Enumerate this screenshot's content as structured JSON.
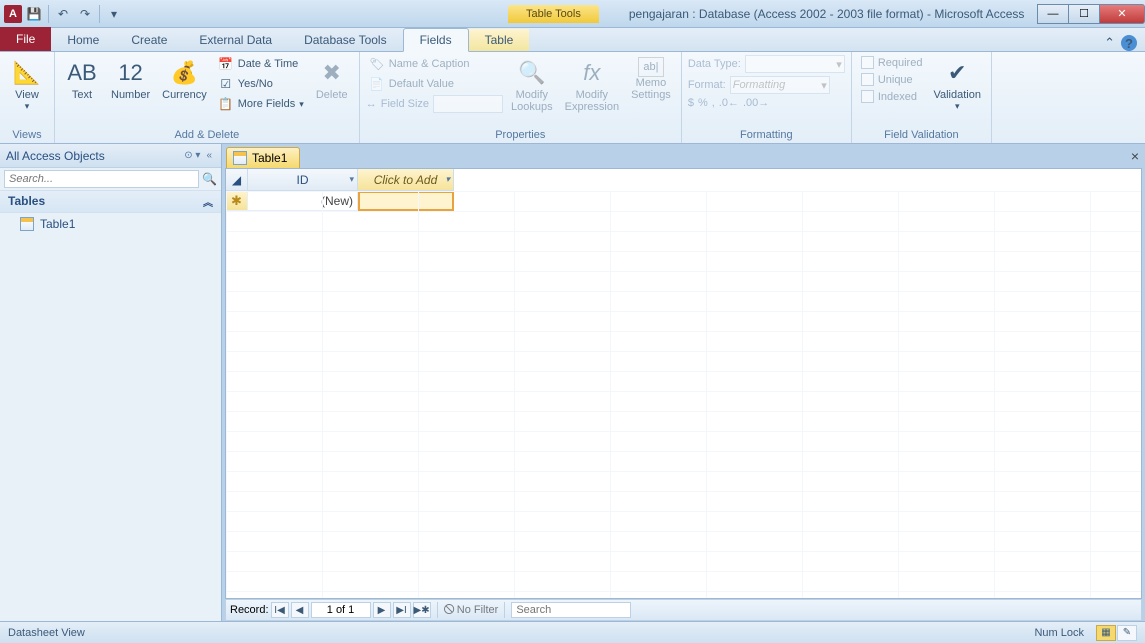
{
  "titlebar": {
    "context_tool": "Table Tools",
    "title": "pengajaran : Database (Access 2002 - 2003 file format)  -  Microsoft Access"
  },
  "tabs": {
    "file": "File",
    "home": "Home",
    "create": "Create",
    "external": "External Data",
    "dbtools": "Database Tools",
    "fields": "Fields",
    "table": "Table"
  },
  "ribbon": {
    "views": {
      "view": "View",
      "group": "Views"
    },
    "add": {
      "text": "Text",
      "number": "Number",
      "currency": "Currency",
      "datetime": "Date & Time",
      "yesno": "Yes/No",
      "more": "More Fields",
      "delete": "Delete",
      "group": "Add & Delete"
    },
    "props": {
      "namecap": "Name & Caption",
      "default": "Default Value",
      "fieldsize": "Field Size",
      "modlook": "Modify\nLookups",
      "modexpr": "Modify\nExpression",
      "memo": "Memo\nSettings",
      "group": "Properties"
    },
    "format": {
      "datatype": "Data Type:",
      "format": "Format:",
      "formatting_ph": "Formatting",
      "group": "Formatting",
      "syms": "%  ,  ←0  .00→"
    },
    "valid": {
      "required": "Required",
      "unique": "Unique",
      "indexed": "Indexed",
      "validation": "Validation",
      "group": "Field Validation"
    }
  },
  "nav": {
    "header": "All Access Objects",
    "search_ph": "Search...",
    "group_tables": "Tables",
    "items": [
      "Table1"
    ]
  },
  "doc": {
    "tab": "Table1",
    "col_id": "ID",
    "col_add": "Click to Add",
    "new_row": "(New)"
  },
  "recnav": {
    "label": "Record:",
    "position": "1 of 1",
    "nofilter": "No Filter",
    "search": "Search"
  },
  "status": {
    "view": "Datasheet View",
    "numlock": "Num Lock"
  }
}
